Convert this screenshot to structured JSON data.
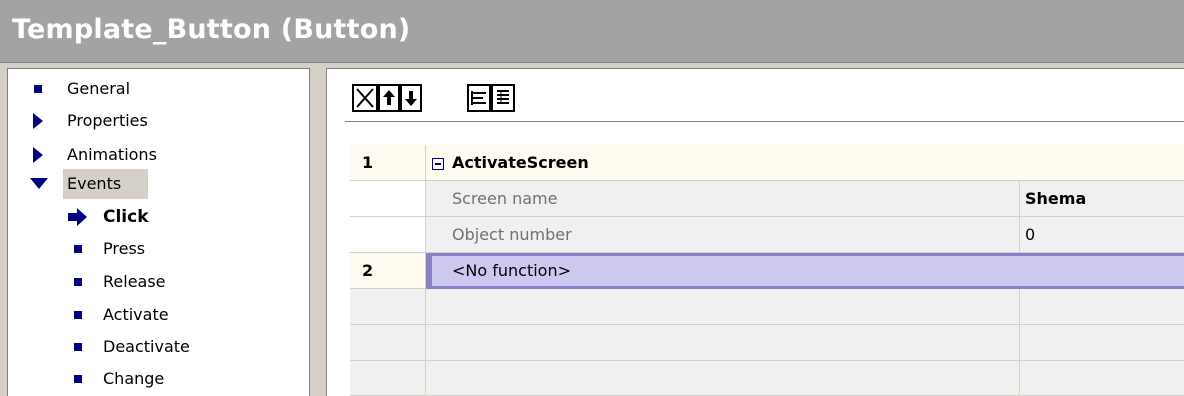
{
  "title": "Template_Button (Button)",
  "nav": {
    "general": "General",
    "properties": "Properties",
    "animations": "Animations",
    "events": "Events",
    "events_children": [
      "Click",
      "Press",
      "Release",
      "Activate",
      "Deactivate",
      "Change"
    ]
  },
  "toolbar": {
    "icons": [
      "delete-icon",
      "move-up-icon",
      "move-down-icon",
      "outdent-icon",
      "list-icon"
    ]
  },
  "grid": {
    "rows": [
      {
        "num": "1",
        "label": "ActivateScreen",
        "value": ""
      },
      {
        "num": "",
        "label": "Screen name",
        "value": "Shema"
      },
      {
        "num": "",
        "label": "Object number",
        "value": "0"
      },
      {
        "num": "2",
        "label": "<No function>",
        "value": ""
      }
    ]
  },
  "colors": {
    "titlebar": "#a3a3a3",
    "function_row": "#fffbf0",
    "selected_row": "#ccc8f0",
    "selected_border": "#8880c8",
    "nav_icon": "#000080"
  }
}
